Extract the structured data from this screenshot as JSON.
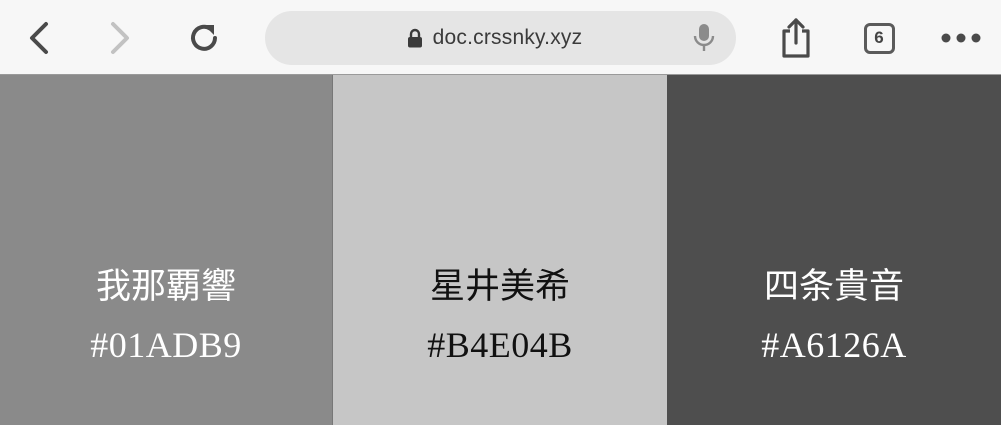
{
  "browser": {
    "url": "doc.crssnky.xyz",
    "tab_count": "6",
    "icons": {
      "back": "chevron-left-icon",
      "forward": "chevron-right-icon",
      "reload": "reload-icon",
      "lock": "lock-icon",
      "mic": "microphone-icon",
      "share": "share-icon",
      "tabs": "tabs-icon",
      "more": "more-dots-icon"
    }
  },
  "panels": [
    {
      "name": "我那覇響",
      "code": "#01ADB9",
      "bg": "#8a8a8a",
      "fg": "#ffffff"
    },
    {
      "name": "星井美希",
      "code": "#B4E04B",
      "bg": "#c6c6c6",
      "fg": "#111111"
    },
    {
      "name": "四条貴音",
      "code": "#A6126A",
      "bg": "#4e4e4e",
      "fg": "#ffffff"
    }
  ]
}
